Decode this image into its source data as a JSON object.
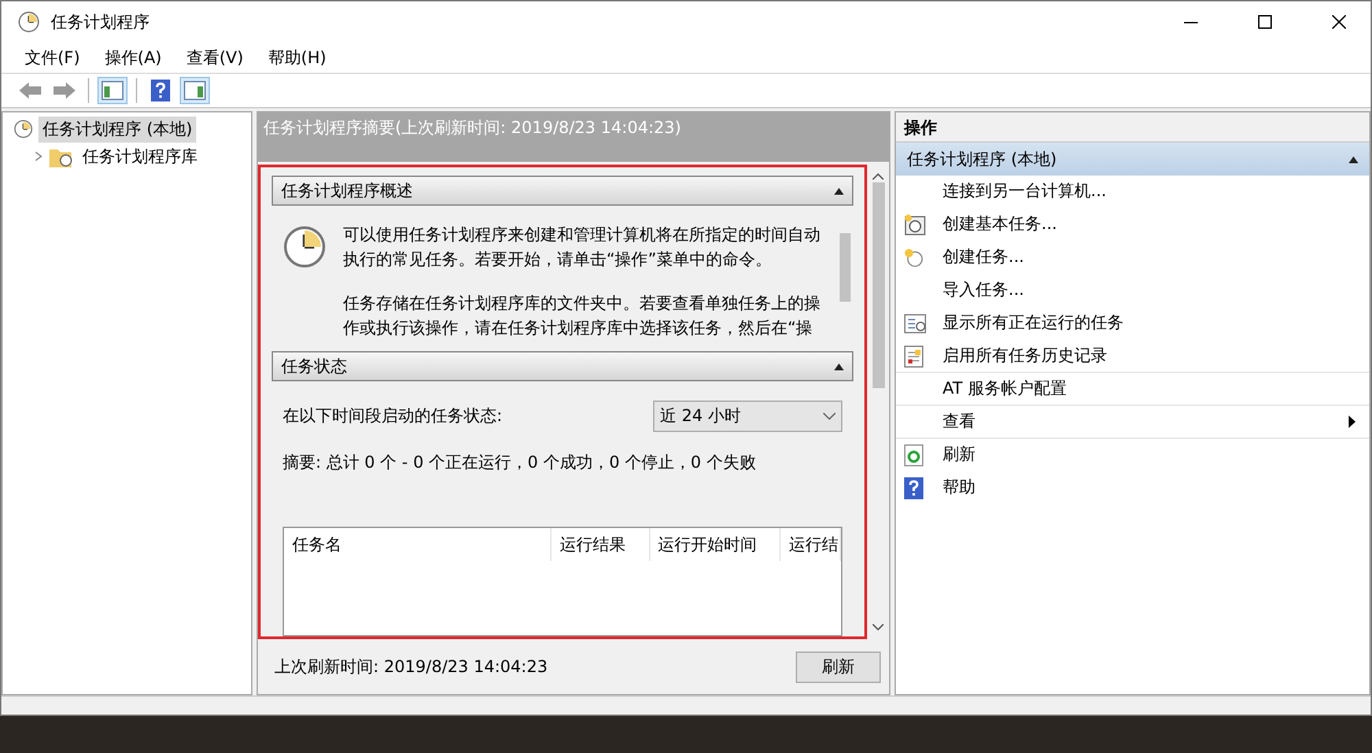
{
  "window": {
    "title": "任务计划程序"
  },
  "menu": [
    "文件(F)",
    "操作(A)",
    "查看(V)",
    "帮助(H)"
  ],
  "tree": [
    {
      "label": "任务计划程序 (本地)",
      "selected": true,
      "children": [
        {
          "label": "任务计划程序库",
          "expanded": false
        }
      ]
    }
  ],
  "summary": {
    "header": "任务计划程序摘要(上次刷新时间: 2019/8/23 14:04:23)",
    "overview": {
      "title": "任务计划程序概述",
      "expanded": true,
      "paragraphs": [
        "可以使用任务计划程序来创建和管理计算机将在所指定的时间自动执行的常见任务。若要开始，请单击“操作”菜单中的命令。",
        "任务存储在任务计划程序库的文件夹中。若要查看单独任务上的操作或执行该操作，请在任务计划程序库中选择该任务，然后在“操"
      ]
    },
    "status": {
      "title": "任务状态",
      "expanded": true,
      "period_label": "在以下时间段启动的任务状态:",
      "period_value": "近 24 小时",
      "summary": "摘要: 总计 0 个 - 0 个正在运行，0 个成功，0 个停止，0 个失败",
      "columns": [
        "任务名",
        "运行结果",
        "运行开始时间",
        "运行结"
      ]
    },
    "last_refresh": "上次刷新时间: 2019/8/23 14:04:23",
    "refresh_button": "刷新"
  },
  "actions": {
    "title": "操作",
    "group": {
      "title": "任务计划程序 (本地)",
      "expanded": true,
      "items": [
        {
          "label": "连接到另一台计算机...",
          "submenu": false
        },
        {
          "label": "创建基本任务...",
          "submenu": false
        },
        {
          "label": "创建任务...",
          "submenu": false
        },
        {
          "label": "导入任务...",
          "submenu": false
        },
        {
          "label": "显示所有正在运行的任务",
          "submenu": false
        },
        {
          "label": "启用所有任务历史记录",
          "submenu": false
        },
        {
          "label": "AT 服务帐户配置",
          "submenu": false
        },
        {
          "label": "查看",
          "submenu": true
        },
        {
          "label": "刷新",
          "submenu": false
        },
        {
          "label": "帮助",
          "submenu": false
        }
      ]
    }
  }
}
